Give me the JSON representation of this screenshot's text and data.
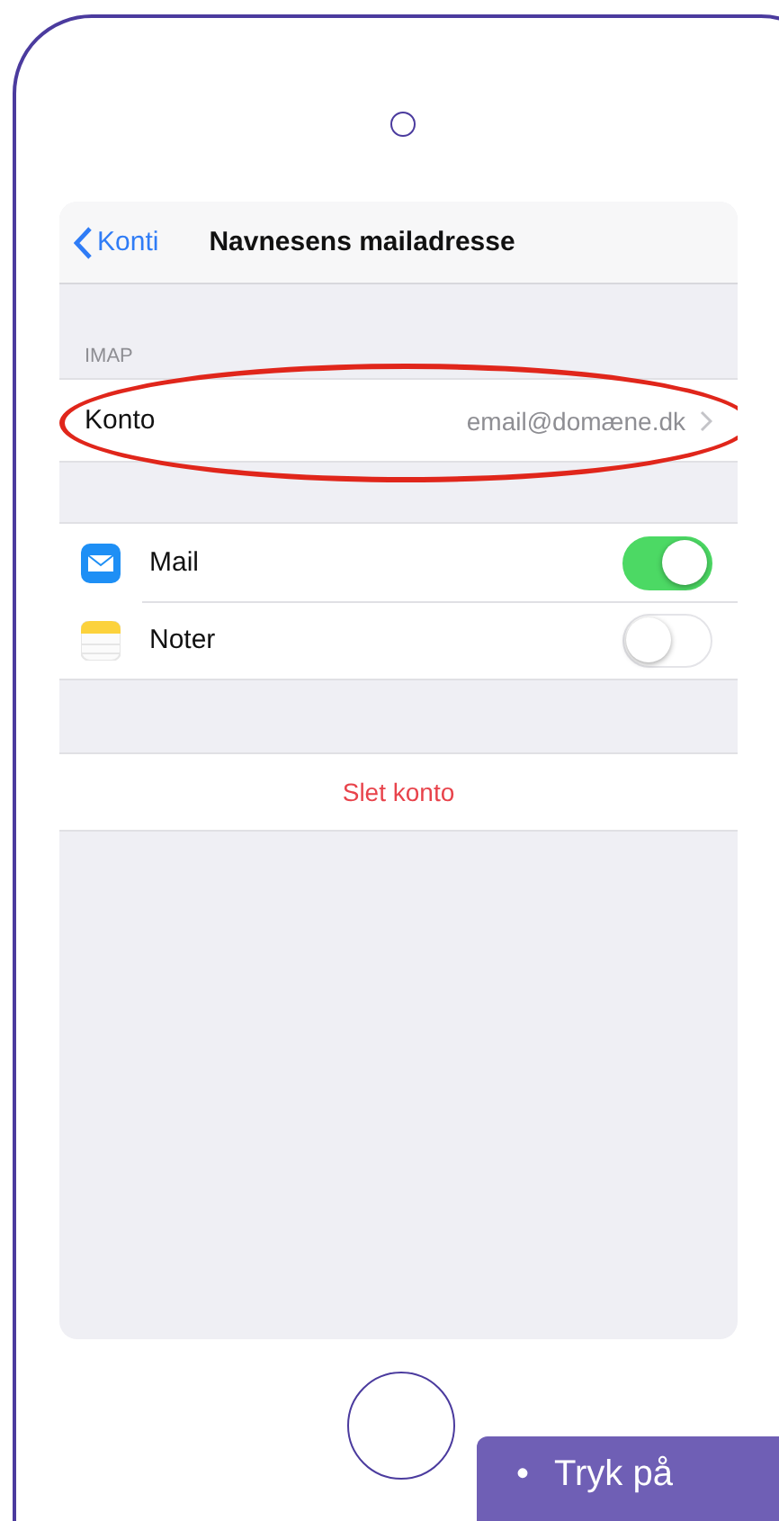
{
  "phone": {
    "nav": {
      "back": "Konti",
      "title": "Navnesens mailadresse"
    },
    "section_header": "IMAP",
    "account_row": {
      "label": "Konto",
      "value": "email@domæne.dk",
      "highlighted": true
    },
    "apps": [
      {
        "kind": "mail",
        "label": "Mail",
        "on": true
      },
      {
        "kind": "notes",
        "label": "Noter",
        "on": false
      }
    ],
    "delete_button": "Slet konto"
  },
  "callout": {
    "bullet": "•",
    "text": "Tryk på"
  }
}
